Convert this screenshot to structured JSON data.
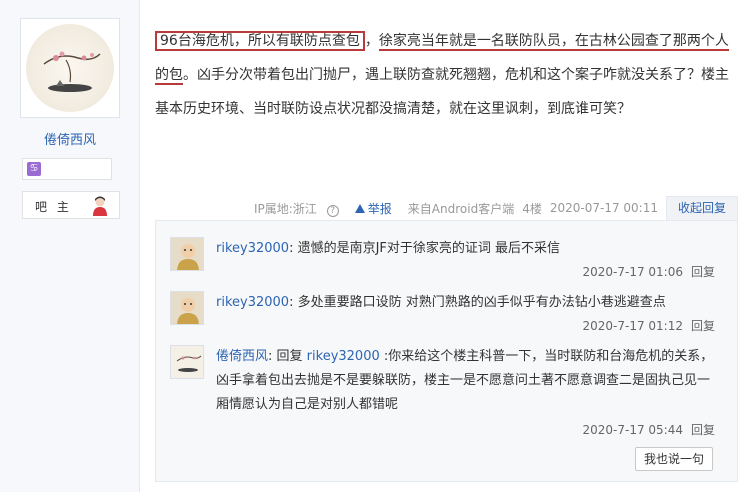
{
  "sidebar": {
    "username": "倦倚西风",
    "badge_icon": "♋",
    "role_label": "吧 主"
  },
  "post": {
    "segments": {
      "boxed": "96台海危机，所以有联防点查包",
      "plain1": "，",
      "underlined1": "徐家亮当年就是一名联防队员，在古林公园查了那两个人",
      "underlined2": "的包",
      "rest": "。凶手分次带着包出门抛尸，遇上联防查就死翘翘，危机和这个案子咋就没关系了？楼主基本历史环境、当时联防设点状况都没搞清楚，就在这里讽刺，到底谁可笑？"
    },
    "meta": {
      "ip": "IP属地:浙江",
      "help_icon": "?",
      "report": "举报",
      "source": "来自Android客户端",
      "floor": "4楼",
      "time": "2020-07-17 00:11",
      "collapse": "收起回复"
    }
  },
  "replies": [
    {
      "user": "rikey32000",
      "sep": ": ",
      "text": "遗憾的是南京JF对于徐家亮的证词 最后不采信",
      "time": "2020-7-17 01:06",
      "reply_label": "回复"
    },
    {
      "user": "rikey32000",
      "sep": ": ",
      "text": "多处重要路口设防 对熟门熟路的凶手似乎有办法钻小巷逃避查点",
      "time": "2020-7-17 01:12",
      "reply_label": "回复"
    },
    {
      "user": "倦倚西风",
      "sep": ": 回复 ",
      "target": "rikey32000",
      "text": " :你来给这个楼主科普一下，当时联防和台海危机的关系，凶手拿着包出去抛是不是要躲联防，楼主一是不愿意问土著不愿意调查二是固执己见一厢情愿认为自己是对别人都错呢",
      "time": "2020-7-17 05:44",
      "reply_label": "回复"
    }
  ],
  "say_button": "我也说一句",
  "colors": {
    "link": "#2d64b3",
    "annotation": "#b83a3a",
    "sidebar_bg": "#f6f8fc",
    "reply_bg": "#f7f8fa"
  }
}
